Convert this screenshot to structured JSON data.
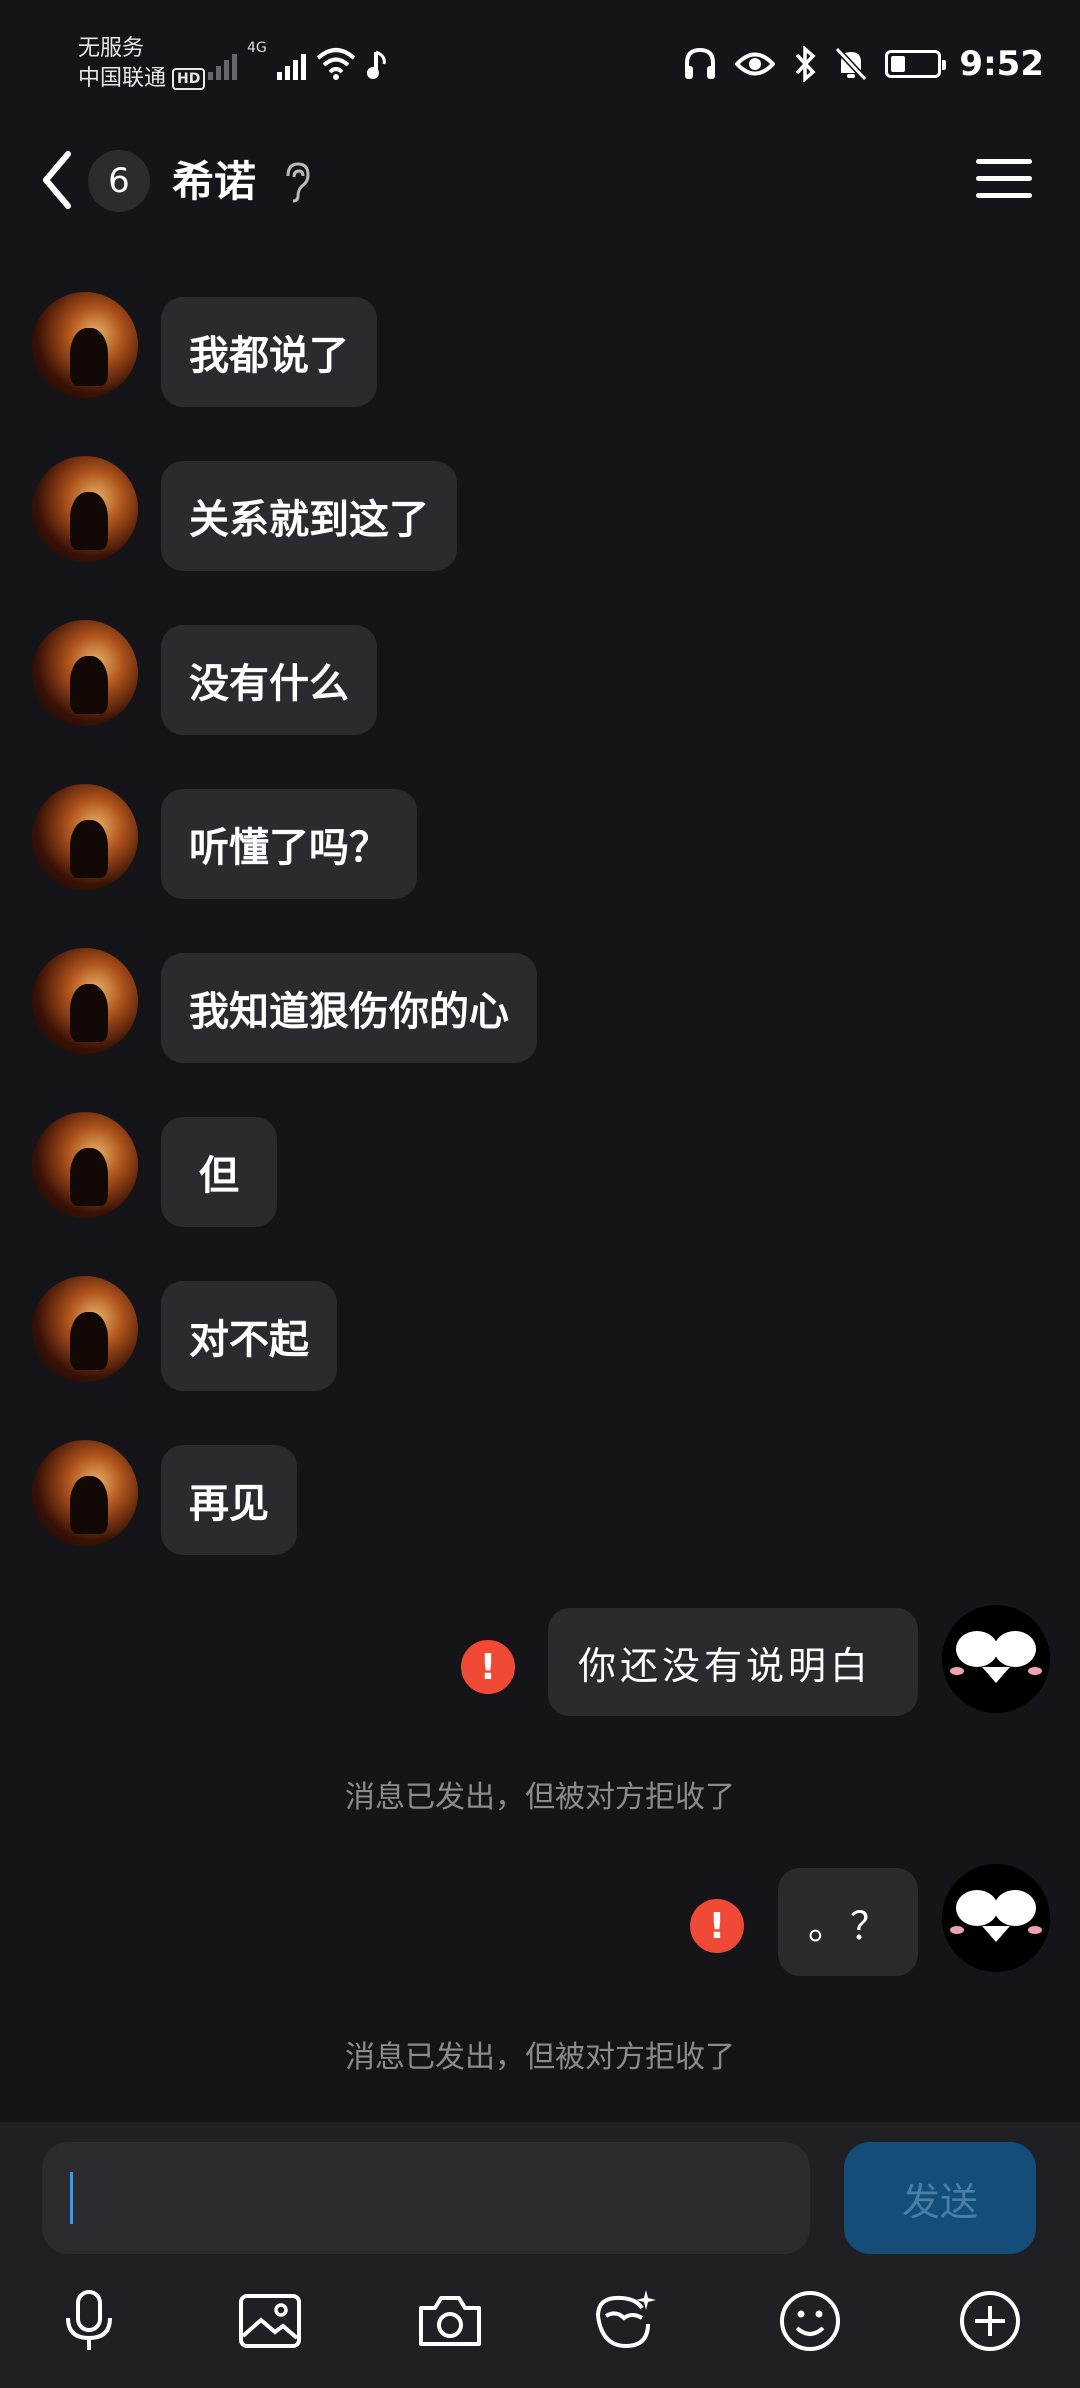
{
  "status_bar": {
    "carrier_line1": "无服务",
    "carrier_line2": "中国联通",
    "hd_label": "HD",
    "network_label": "4G",
    "time": "9:52",
    "battery_level": 0.3,
    "icons": [
      "headphones-icon",
      "eye-icon",
      "bluetooth-icon",
      "bell-muted-icon",
      "battery-icon"
    ]
  },
  "header": {
    "unread_count": "6",
    "contact_name": "希诺",
    "icons": [
      "back-arrow-icon",
      "ear-icon",
      "menu-icon"
    ]
  },
  "messages_in": [
    "我都说了",
    "关系就到这了",
    "没有什么",
    "听懂了吗？",
    "我知道狠伤你的心",
    "但",
    "对不起",
    "再见"
  ],
  "messages_out": [
    {
      "text": "你还没有说明白",
      "status": "消息已发出，但被对方拒收了"
    },
    {
      "text": "。？",
      "status": "消息已发出，但被对方拒收了"
    }
  ],
  "error_mark": "!",
  "input": {
    "value": "",
    "send_label": "发送"
  },
  "toolbar": {
    "icons": [
      "microphone-icon",
      "image-icon",
      "camera-icon",
      "sticker-icon",
      "emoji-icon",
      "plus-circle-icon"
    ]
  },
  "colors": {
    "background": "#151519",
    "bubble": "#2a2a2f",
    "error": "#f04a37",
    "send_button": "#134d78",
    "cursor": "#2a9df4"
  }
}
